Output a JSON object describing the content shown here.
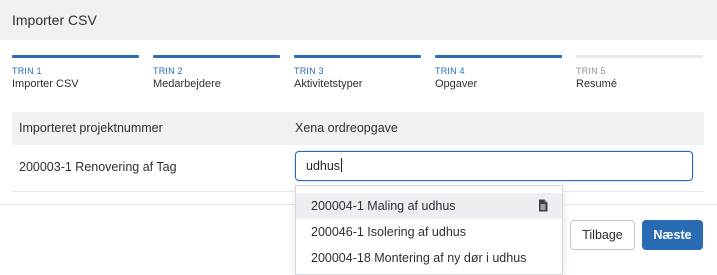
{
  "dialog": {
    "title": "Importer CSV"
  },
  "steps": [
    {
      "num": "TRIN 1",
      "label": "Importer CSV",
      "state": "done"
    },
    {
      "num": "TRIN 2",
      "label": "Medarbejdere",
      "state": "done"
    },
    {
      "num": "TRIN 3",
      "label": "Aktivitetstyper",
      "state": "done"
    },
    {
      "num": "TRIN 4",
      "label": "Opgaver",
      "state": "active"
    },
    {
      "num": "TRIN 5",
      "label": "Resumé",
      "state": "pending"
    }
  ],
  "table": {
    "columns": [
      "Importeret projektnummer",
      "Xena ordreopgave"
    ],
    "rows": [
      {
        "project": "200003-1 Renovering af Tag",
        "search_value": "udhus"
      }
    ]
  },
  "dropdown": {
    "options": [
      "200004-1 Maling af udhus",
      "200046-1 Isolering af udhus",
      "200004-18 Montering af ny dør i udhus"
    ],
    "highlighted_index": 0,
    "highlighted_icon": "document-icon"
  },
  "footer": {
    "back_label": "Tilbage",
    "next_label": "Næste"
  },
  "colors": {
    "accent": "#2a6cb3",
    "header_bg": "#f0f1f3",
    "pending_bar": "#e6e8eb"
  }
}
